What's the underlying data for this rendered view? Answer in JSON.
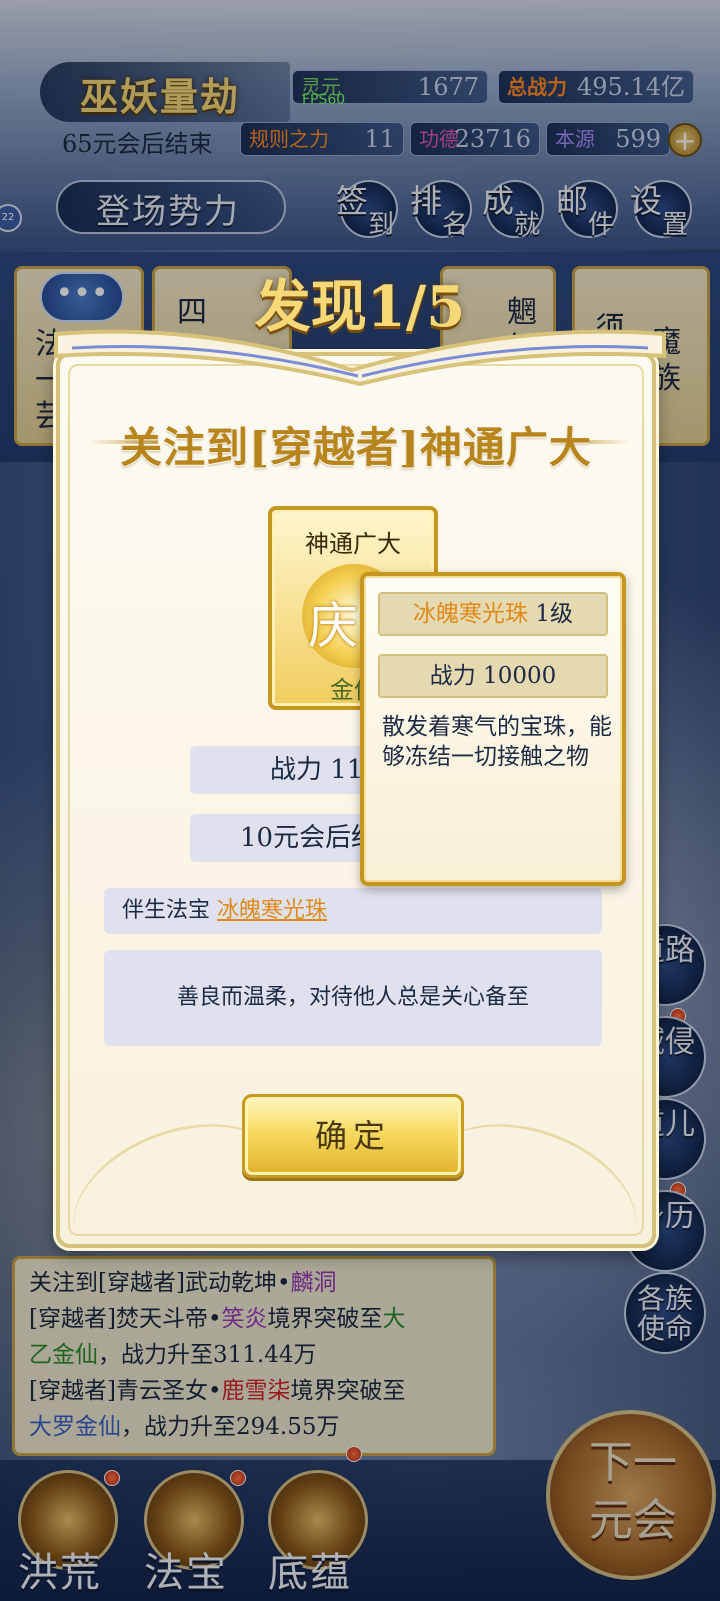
{
  "header": {
    "game_title": "巫妖量劫",
    "fps": "FPS60",
    "spirit_label": "灵元",
    "spirit_value": "1677",
    "power_label": "总战力",
    "power_value": "495.14亿",
    "end_text": "65元会后结束",
    "rule_label": "规则之力",
    "rule_value": "11",
    "merit_label": "功德",
    "merit_value": "23716",
    "origin_label": "本源",
    "origin_value": "599",
    "plus": "+",
    "faction_label": "登场势力",
    "left_badge": "22",
    "menu": [
      {
        "a": "签",
        "b": "到"
      },
      {
        "a": "排",
        "b": "名"
      },
      {
        "a": "成",
        "b": "就"
      },
      {
        "a": "邮",
        "b": "件"
      },
      {
        "a": "设",
        "b": "置"
      }
    ]
  },
  "cards": [
    {
      "name": "法一芸"
    },
    {
      "name": "四"
    },
    {
      "name": "魍魉"
    },
    {
      "name": "须"
    },
    {
      "name": "魔族"
    }
  ],
  "chat_icon": "•••",
  "side_buttons": [
    {
      "label": "道路"
    },
    {
      "label": "域侵"
    },
    {
      "label": "道儿"
    },
    {
      "label": "身历"
    },
    {
      "label": "各族使命"
    }
  ],
  "log": {
    "line1_prefix": "关注到[穿越者]武动乾坤•",
    "line1_name": "麟洞",
    "line2_prefix": "[穿越者]焚天斗帝•",
    "line2_name": "笑炎",
    "line2_mid": "境界突破至",
    "line2_realm": "大",
    "line3_realm": "乙金仙",
    "line3_rest": "，战力升至311.44万",
    "line4_prefix": "[穿越者]青云圣女•",
    "line4_name": "鹿雪柒",
    "line4_mid": "境界突破至",
    "line5_realm": "大罗金仙",
    "line5_rest": "，战力升至294.55万"
  },
  "bottom_nav": [
    {
      "label": "洪荒"
    },
    {
      "label": "法宝"
    },
    {
      "label": "底蕴"
    }
  ],
  "next_era": "下一元会",
  "dialog": {
    "title": "发现1/5",
    "heading": "关注到[穿越者]神通广大",
    "card_name": "神通广大",
    "card_emblem": "庆",
    "card_grade": "金仙",
    "power_text": "战力 11",
    "duration_text": "10元会后结",
    "treasure_label": "伴生法宝",
    "treasure_name": "冰魄寒光珠",
    "description": "善良而温柔，对待他人总是关心备至",
    "confirm": "确定"
  },
  "tooltip": {
    "item_name": "冰魄寒光珠",
    "item_level": "1级",
    "power": "战力 10000",
    "description": "散发着寒气的宝珠，能够冻结一切接触之物"
  }
}
